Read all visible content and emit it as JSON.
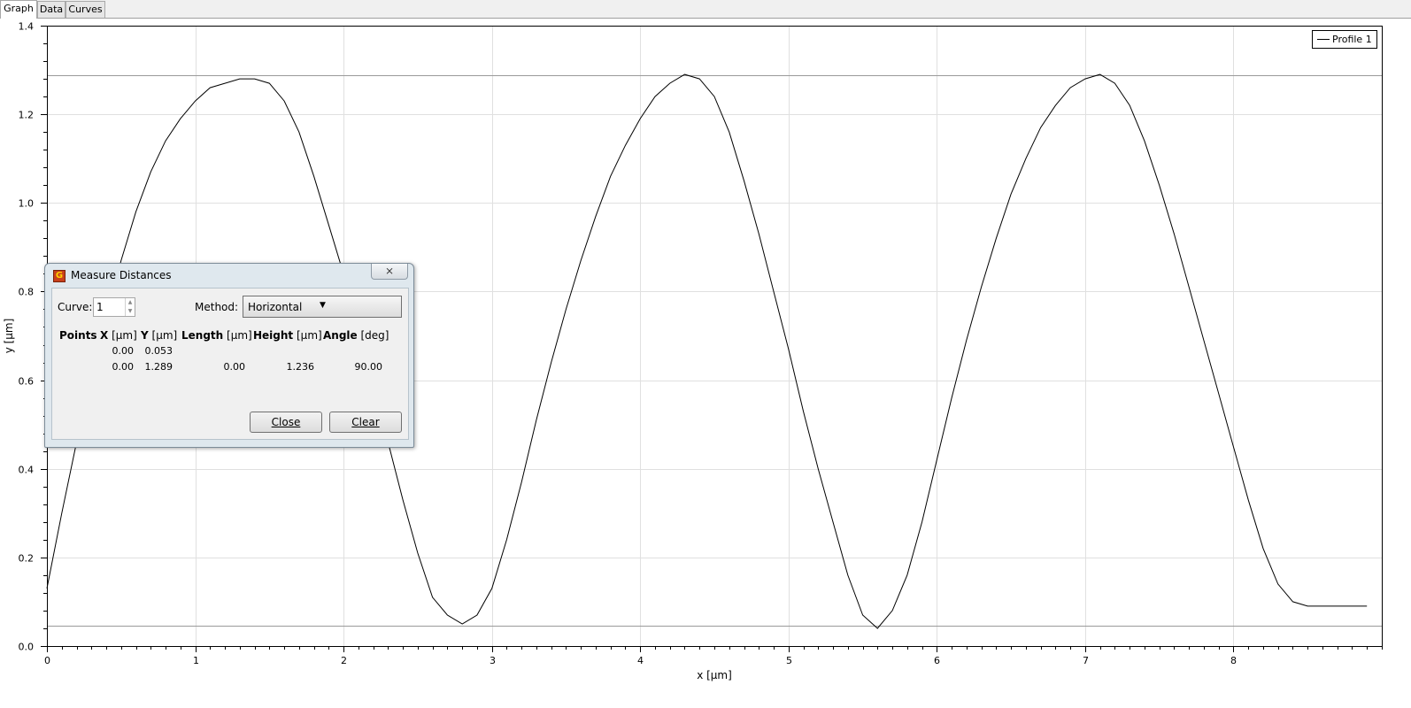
{
  "tabs": [
    {
      "label": "Graph",
      "active": true
    },
    {
      "label": "Data",
      "active": false
    },
    {
      "label": "Curves",
      "active": false
    }
  ],
  "graph": {
    "legend": {
      "label": "Profile 1"
    },
    "colors": {
      "curve": "#000000",
      "grid": "#e0e0e0",
      "marker_line": "#9a9a9a"
    },
    "marker_lines_y": [
      1.289,
      0.045
    ]
  },
  "chart_data": {
    "type": "line",
    "xlabel": "x [µm]",
    "ylabel": "y [µm]",
    "xlim": [
      0,
      9
    ],
    "ylim": [
      0,
      1.4
    ],
    "x_ticks": [
      "0",
      "1",
      "2",
      "3",
      "4",
      "5",
      "6",
      "7",
      "8"
    ],
    "y_ticks": [
      "0.0",
      "0.2",
      "0.4",
      "0.6",
      "0.8",
      "1.0",
      "1.2",
      "1.4"
    ],
    "grid": true,
    "legend_position": "top-right",
    "series": [
      {
        "name": "Profile 1",
        "x": [
          0.0,
          0.1,
          0.2,
          0.3,
          0.4,
          0.5,
          0.6,
          0.7,
          0.8,
          0.9,
          1.0,
          1.1,
          1.2,
          1.3,
          1.4,
          1.5,
          1.6,
          1.7,
          1.8,
          1.9,
          2.0,
          2.1,
          2.2,
          2.3,
          2.4,
          2.5,
          2.6,
          2.7,
          2.8,
          2.9,
          3.0,
          3.1,
          3.2,
          3.3,
          3.4,
          3.5,
          3.6,
          3.7,
          3.8,
          3.9,
          4.0,
          4.1,
          4.2,
          4.3,
          4.4,
          4.5,
          4.6,
          4.7,
          4.8,
          4.9,
          5.0,
          5.1,
          5.2,
          5.3,
          5.4,
          5.5,
          5.6,
          5.7,
          5.8,
          5.9,
          6.0,
          6.1,
          6.2,
          6.3,
          6.4,
          6.5,
          6.6,
          6.7,
          6.8,
          6.9,
          7.0,
          7.1,
          7.2,
          7.3,
          7.4,
          7.5,
          7.6,
          7.7,
          7.8,
          7.9,
          8.0,
          8.1,
          8.2,
          8.3,
          8.4,
          8.5,
          8.6,
          8.7,
          8.8,
          8.9
        ],
        "y": [
          0.13,
          0.3,
          0.46,
          0.61,
          0.74,
          0.87,
          0.98,
          1.07,
          1.14,
          1.19,
          1.23,
          1.26,
          1.27,
          1.28,
          1.28,
          1.27,
          1.23,
          1.16,
          1.06,
          0.95,
          0.84,
          0.73,
          0.6,
          0.46,
          0.33,
          0.21,
          0.11,
          0.07,
          0.05,
          0.07,
          0.13,
          0.24,
          0.37,
          0.51,
          0.64,
          0.76,
          0.87,
          0.97,
          1.06,
          1.13,
          1.19,
          1.24,
          1.27,
          1.29,
          1.28,
          1.24,
          1.16,
          1.05,
          0.93,
          0.8,
          0.67,
          0.53,
          0.4,
          0.28,
          0.16,
          0.07,
          0.04,
          0.08,
          0.16,
          0.28,
          0.42,
          0.56,
          0.69,
          0.81,
          0.92,
          1.02,
          1.1,
          1.17,
          1.22,
          1.26,
          1.28,
          1.29,
          1.27,
          1.22,
          1.14,
          1.04,
          0.93,
          0.81,
          0.69,
          0.57,
          0.45,
          0.33,
          0.22,
          0.14,
          0.1,
          0.09,
          0.09,
          0.09,
          0.09,
          0.09
        ]
      }
    ]
  },
  "dialog": {
    "title": "Measure Distances",
    "close_symbol": "⨯",
    "curve_label": "Curve:",
    "curve_value": "1",
    "method_label": "Method:",
    "method_value": "Horizontal",
    "headers": {
      "points": "Points",
      "x_bold": "X",
      "x_unit": "[µm]",
      "y_bold": "Y",
      "y_unit": "[µm]",
      "length_bold": "Length",
      "length_unit": "[µm]",
      "height_bold": "Height",
      "height_unit": "[µm]",
      "angle_bold": "Angle",
      "angle_unit": "[deg]"
    },
    "rows": [
      {
        "x": "0.00",
        "y": "0.053",
        "length": "",
        "height": "",
        "angle": ""
      },
      {
        "x": "0.00",
        "y": "1.289",
        "length": "0.00",
        "height": "1.236",
        "angle": "90.00"
      }
    ],
    "close_button": "Close",
    "clear_button": "Clear"
  }
}
